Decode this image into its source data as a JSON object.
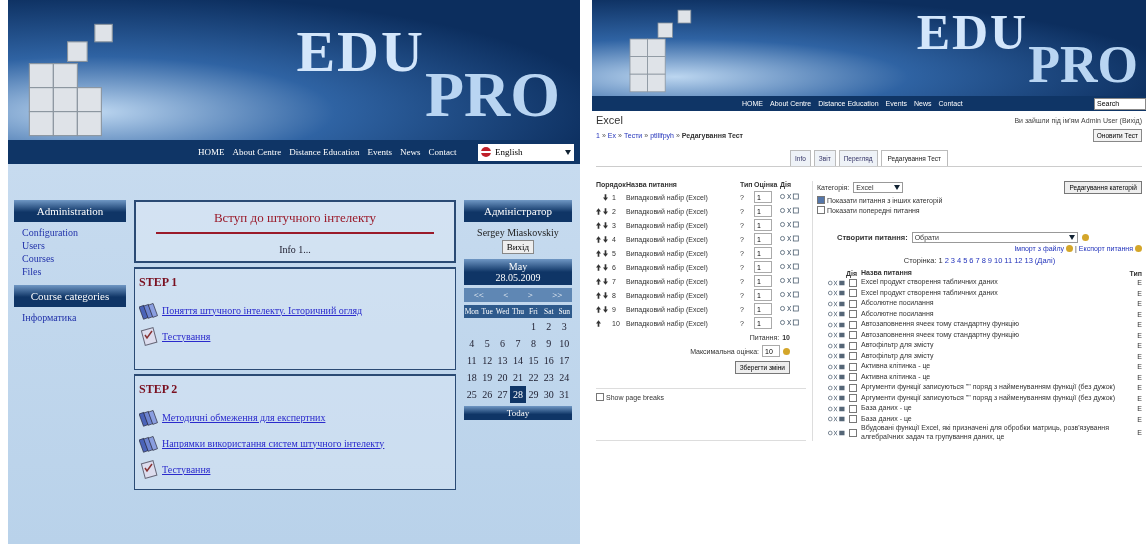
{
  "left_site": {
    "logo": {
      "edu": "EDU",
      "pro": "PRO"
    },
    "nav": [
      "HOME",
      "About Centre",
      "Distance Education",
      "Events",
      "News",
      "Contact"
    ],
    "language": "English",
    "admin_block": {
      "title": "Administration",
      "items": [
        "Configuration",
        "Users",
        "Courses",
        "Files"
      ]
    },
    "categories_block": {
      "title": "Course categories",
      "items": [
        "Інформатика"
      ]
    },
    "course": {
      "title": "Вступ до штучного інтелекту",
      "info": "Info 1..."
    },
    "steps": [
      {
        "title": "STEP 1",
        "items": [
          {
            "kind": "resource",
            "label": "Поняття штучного інтелекту. Історичний огляд"
          },
          {
            "kind": "quiz",
            "label": "Тестування"
          }
        ]
      },
      {
        "title": "STEP 2",
        "items": [
          {
            "kind": "resource",
            "label": "Методичні обмеження для експертних"
          },
          {
            "kind": "resource",
            "label": "Напрямки використання систем штучного інтелекту"
          },
          {
            "kind": "quiz",
            "label": "Тестування"
          }
        ]
      }
    ],
    "user_block": {
      "title": "Адміністратор",
      "name": "Sergey Miaskovskiy",
      "logout": "Вихід"
    },
    "calendar": {
      "month": "May",
      "date": "28.05.2009",
      "nav": [
        "<<",
        "<",
        ">",
        ">>"
      ],
      "weekdays": [
        "Mon",
        "Tue",
        "Wed",
        "Thu",
        "Fri",
        "Sat",
        "Sun"
      ],
      "weeks": [
        [
          {
            "d": "1",
            "selected": false
          },
          {
            "d": "2",
            "selected": false
          },
          {
            "d": "3",
            "selected": false
          }
        ],
        [
          {
            "d": "4",
            "selected": false
          },
          {
            "d": "5",
            "selected": false
          },
          {
            "d": "6",
            "selected": false
          },
          {
            "d": "7",
            "selected": false
          },
          {
            "d": "8",
            "selected": false
          },
          {
            "d": "9",
            "selected": false
          },
          {
            "d": "10",
            "selected": false
          }
        ],
        [
          {
            "d": "11",
            "selected": false
          },
          {
            "d": "12",
            "selected": false
          },
          {
            "d": "13",
            "selected": false
          },
          {
            "d": "14",
            "selected": false
          },
          {
            "d": "15",
            "selected": false
          },
          {
            "d": "16",
            "selected": false
          },
          {
            "d": "17",
            "selected": false
          }
        ],
        [
          {
            "d": "18",
            "selected": false
          },
          {
            "d": "19",
            "selected": false
          },
          {
            "d": "20",
            "selected": false
          },
          {
            "d": "21",
            "selected": false
          },
          {
            "d": "22",
            "selected": false
          },
          {
            "d": "23",
            "selected": false
          },
          {
            "d": "24",
            "selected": false
          }
        ],
        [
          {
            "d": "25",
            "selected": false
          },
          {
            "d": "26",
            "selected": false
          },
          {
            "d": "27",
            "selected": false
          },
          {
            "d": "28",
            "selected": true
          },
          {
            "d": "29",
            "selected": false
          },
          {
            "d": "30",
            "selected": false
          },
          {
            "d": "31",
            "selected": false
          }
        ]
      ],
      "footer": "Today"
    }
  },
  "right_site": {
    "logo": {
      "edu": "EDU",
      "pro": "PRO"
    },
    "nav": [
      "HOME",
      "About Centre",
      "Distance Education",
      "Events",
      "News",
      "Contact"
    ],
    "search": "Search",
    "page_title": "Excel",
    "breadcrumb": [
      "1",
      "Ex",
      "Тести",
      "ptlllfpyh",
      "Редагування Тест"
    ],
    "breadcrumb_separator": "»",
    "login_info": "Ви зайшли під ім'ям Admin User (Вихід)",
    "update_button": "Оновити Тест",
    "tabs": [
      {
        "label": "Info",
        "selected": false
      },
      {
        "label": "Звіт",
        "selected": false
      },
      {
        "label": "Перегляд",
        "selected": false
      },
      {
        "label": "Редагування Тест",
        "selected": true
      }
    ],
    "quiz_table": {
      "columns": [
        "Порядок",
        "Назва питання",
        "Тип",
        "Оцінка",
        "Дія"
      ],
      "rows": [
        {
          "num": "1",
          "name": "Випадковий набір (Excel)",
          "type": "?",
          "grade": "1",
          "up": false,
          "down": true
        },
        {
          "num": "2",
          "name": "Випадковий набір (Excel)",
          "type": "?",
          "grade": "1",
          "up": true,
          "down": true
        },
        {
          "num": "3",
          "name": "Випадковий набір (Excel)",
          "type": "?",
          "grade": "1",
          "up": true,
          "down": true
        },
        {
          "num": "4",
          "name": "Випадковий набір (Excel)",
          "type": "?",
          "grade": "1",
          "up": true,
          "down": true
        },
        {
          "num": "5",
          "name": "Випадковий набір (Excel)",
          "type": "?",
          "grade": "1",
          "up": true,
          "down": true
        },
        {
          "num": "6",
          "name": "Випадковий набір (Excel)",
          "type": "?",
          "grade": "1",
          "up": true,
          "down": true
        },
        {
          "num": "7",
          "name": "Випадковий набір (Excel)",
          "type": "?",
          "grade": "1",
          "up": true,
          "down": true
        },
        {
          "num": "8",
          "name": "Випадковий набір (Excel)",
          "type": "?",
          "grade": "1",
          "up": true,
          "down": true
        },
        {
          "num": "9",
          "name": "Випадковий набір (Excel)",
          "type": "?",
          "grade": "1",
          "up": true,
          "down": true
        },
        {
          "num": "10",
          "name": "Випадковий набір (Excel)",
          "type": "?",
          "grade": "1",
          "up": true,
          "down": false
        }
      ],
      "questions_label": "Питання:",
      "questions_count": "10",
      "max_grade_label": "Максимальна оцінка:",
      "max_grade": "10",
      "save_button": "Зберегти зміни"
    },
    "page_breaks": {
      "label": "Show page breaks",
      "checked": false
    },
    "bank": {
      "category_label": "Категорія:",
      "category": "Excel",
      "options": [
        {
          "label": "Показати питання з інших категорій",
          "checked": true
        },
        {
          "label": "Показати попередні питання",
          "checked": false
        }
      ],
      "edit_categories_button": "Редагування категорій",
      "create_label": "Створити питання:",
      "create_select": "Обрати",
      "links": [
        "Імпорт з файлу",
        "Експорт питання"
      ],
      "links_separator": "|",
      "pages_label": "Сторінка:",
      "pages": [
        {
          "n": "1",
          "selected": true
        },
        {
          "n": "2",
          "selected": false
        },
        {
          "n": "3",
          "selected": false
        },
        {
          "n": "4",
          "selected": false
        },
        {
          "n": "5",
          "selected": false
        },
        {
          "n": "6",
          "selected": false
        },
        {
          "n": "7",
          "selected": false
        },
        {
          "n": "8",
          "selected": false
        },
        {
          "n": "9",
          "selected": false
        },
        {
          "n": "10",
          "selected": false
        },
        {
          "n": "11",
          "selected": false
        },
        {
          "n": "12",
          "selected": false
        },
        {
          "n": "13",
          "selected": false
        }
      ],
      "next": "(Далі)",
      "columns": [
        "Дія",
        "Назва питання",
        "Тип"
      ],
      "questions": [
        {
          "name": "Excel продукт створення табличних даних",
          "type": "E",
          "checked": false
        },
        {
          "name": "Excel продукт створення табличних даних",
          "type": "E",
          "checked": false
        },
        {
          "name": "Абсолютне посилання",
          "type": "E",
          "checked": false
        },
        {
          "name": "Абсолютне посилання",
          "type": "E",
          "checked": false
        },
        {
          "name": "Автозаповнення ячеек тому стандартну функцію",
          "type": "E",
          "checked": false
        },
        {
          "name": "Автозаповнення ячеек тому стандартну функцію",
          "type": "E",
          "checked": false
        },
        {
          "name": "Автофільтр для змісту",
          "type": "E",
          "checked": false
        },
        {
          "name": "Автофільтр для змісту",
          "type": "E",
          "checked": false
        },
        {
          "name": "Активна клітинка - це",
          "type": "E",
          "checked": false
        },
        {
          "name": "Активна клітинка - це",
          "type": "E",
          "checked": false
        },
        {
          "name": "Аргументи функції записуються \"\" поряд з найменуванням функції (без дужок)",
          "type": "E",
          "checked": false
        },
        {
          "name": "Аргументи функції записуються \"\" поряд з найменуванням функції (без дужок)",
          "type": "E",
          "checked": false
        },
        {
          "name": "База даних - це",
          "type": "E",
          "checked": false
        },
        {
          "name": "База даних - це",
          "type": "E",
          "checked": false
        },
        {
          "name": "Вбудовані функції Excel, які призначені для обробки матриць, розв'язування алгебраїчних задач та групування даних, це",
          "type": "E",
          "checked": false
        }
      ]
    }
  }
}
